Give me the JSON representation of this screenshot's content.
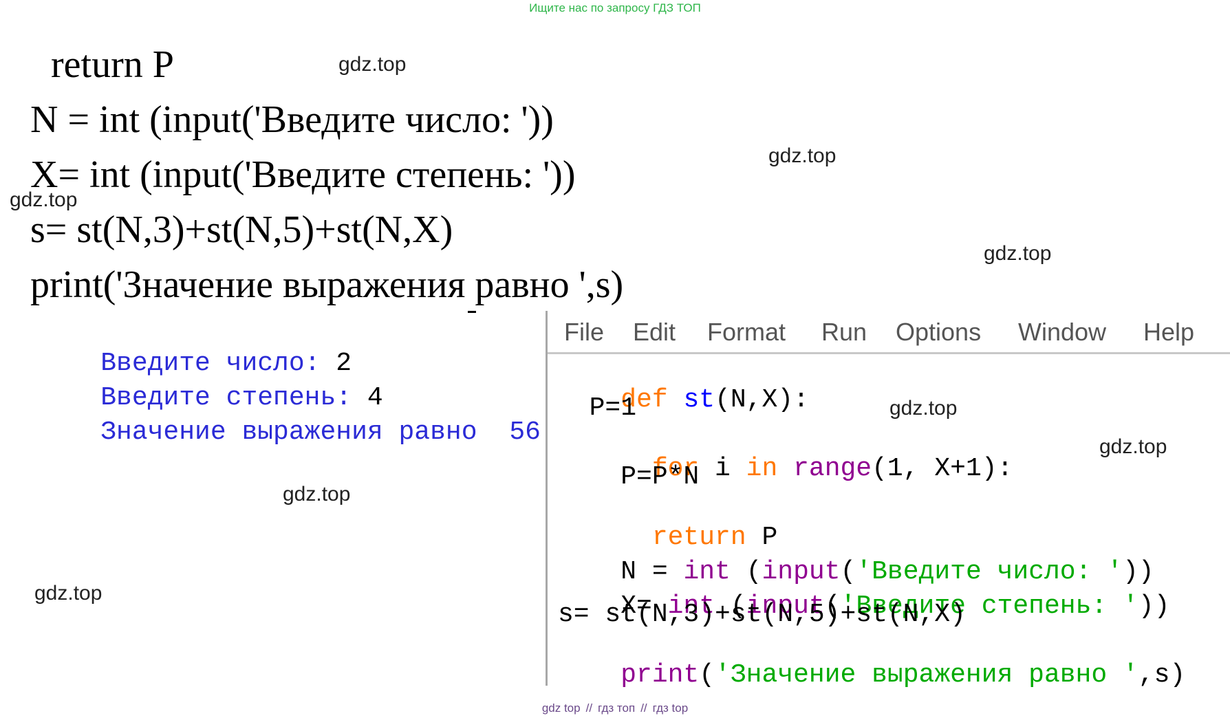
{
  "banners": {
    "top": "Ищите нас по запросу ГДЗ ТОП",
    "bottom_parts": [
      "gdz top",
      "//",
      "гдз топ",
      "//",
      "гдз top"
    ]
  },
  "watermark": "gdz.top",
  "printed_code": {
    "lines": [
      "return P",
      "N = int (input('Введите число: '))",
      "X= int (input('Введите степень: '))",
      "s= st(N,3)+st(N,5)+st(N,X)",
      "print('Значение выражения равно ',s)"
    ]
  },
  "shell": {
    "line1_prompt": "Введите число: ",
    "line1_value": "2",
    "line2_prompt": "Введите степень: ",
    "line2_value": "4",
    "line3_text": "Значение выражения равно ",
    "line3_value": "56"
  },
  "editor": {
    "menu": [
      "File",
      "Edit",
      "Format",
      "Run",
      "Options",
      "Window",
      "Help"
    ],
    "code": {
      "l1_kw": "def",
      "l1_fn": "st",
      "l1_rest": "(N,X):",
      "l2": "  P=1",
      "l3_kw1": "for",
      "l3_mid1": " i ",
      "l3_kw2": "in",
      "l3_bi": "range",
      "l3_rest": "(1, X+1):",
      "l4": "    P=P*N",
      "l5_kw": "return",
      "l5_rest": " P",
      "l6_a": "N = ",
      "l6_int": "int",
      "l6_b": " (",
      "l6_input": "input",
      "l6_c": "(",
      "l6_str": "'Введите число: '",
      "l6_d": "))",
      "l7_a": "X= ",
      "l7_int": "int",
      "l7_b": " (",
      "l7_input": "input",
      "l7_c": "(",
      "l7_str": "'Введите степень: '",
      "l7_d": "))",
      "l8": "s= st(N,3)+st(N,5)+st(N,X)",
      "l9_print": "print",
      "l9_a": "(",
      "l9_str": "'Значение выражения равно '",
      "l9_b": ",s)"
    }
  },
  "colors": {
    "keyword": "#ff7700",
    "builtin": "#900090",
    "function_name": "#0000ff",
    "string": "#00aa00",
    "shell_prompt": "#2b2bd6",
    "banner_green": "#2fb64a"
  }
}
